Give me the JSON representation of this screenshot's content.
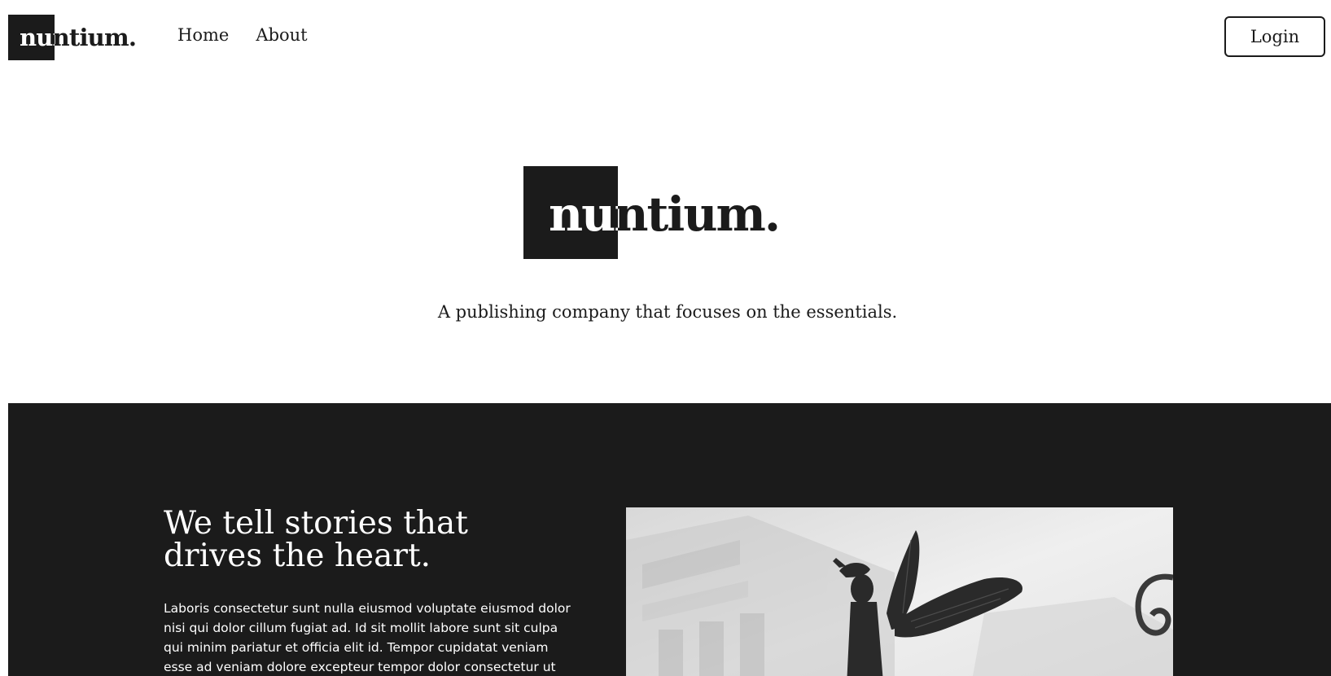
{
  "header": {
    "logo_text": "nuntium.",
    "nav": [
      {
        "label": "Home"
      },
      {
        "label": "About"
      }
    ],
    "login_label": "Login"
  },
  "hero": {
    "logo_text": "nuntium.",
    "tagline": "A publishing company that focuses on the essentials."
  },
  "story": {
    "title": "We tell stories that drives the heart.",
    "body": "Laboris consectetur sunt nulla eiusmod voluptate eiusmod dolor nisi qui dolor cillum fugiat ad. Id sit mollit labore sunt sit culpa qui minim pariatur et officia elit id. Tempor cupidatat veniam esse ad veniam dolore excepteur tempor dolor consectetur ut id.",
    "image_subject": "winged-angel-statue-photo"
  },
  "colors": {
    "primary": "#1b1b1b",
    "background": "#ffffff",
    "on_dark": "#ffffff"
  }
}
